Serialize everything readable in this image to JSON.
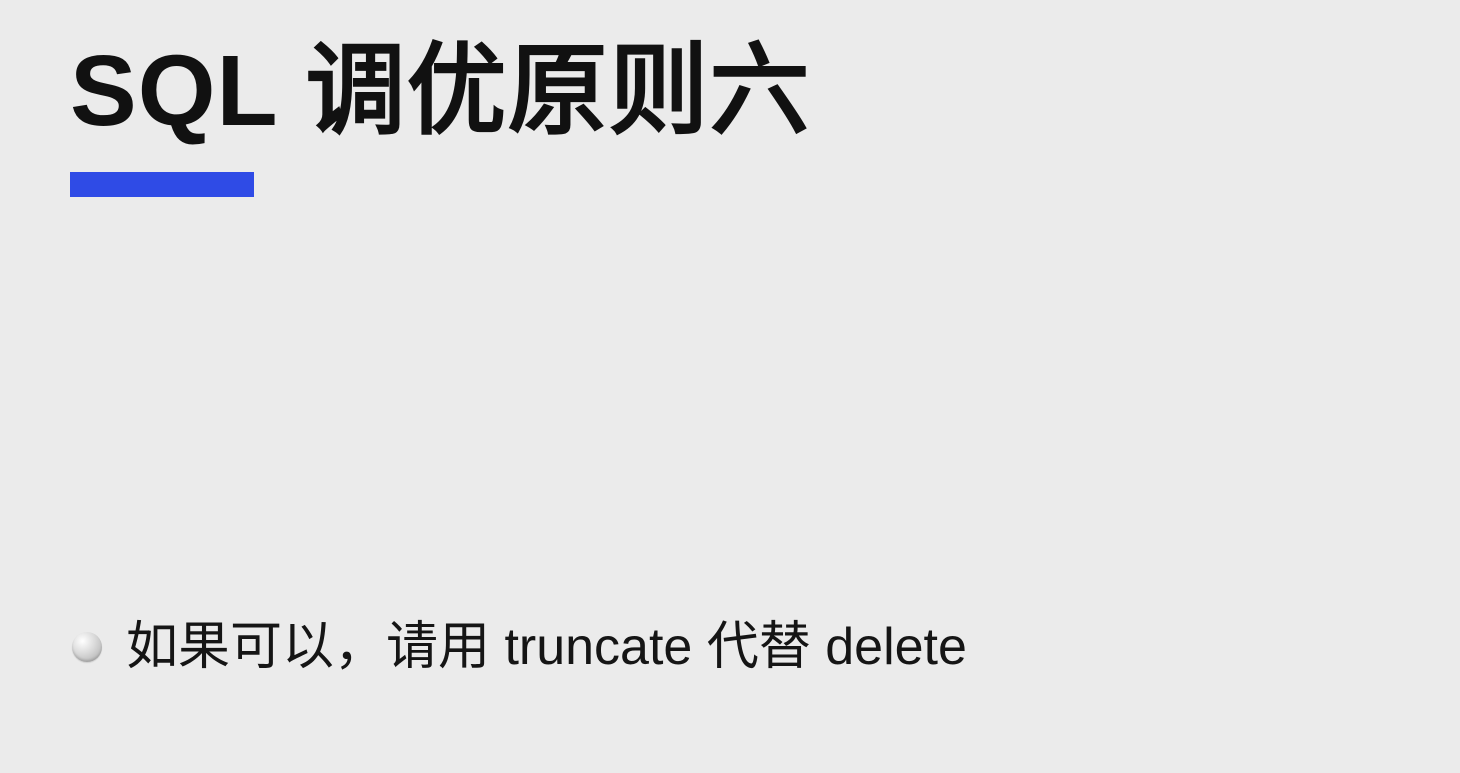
{
  "slide": {
    "title": "SQL 调优原则六",
    "accent_color": "#2f4be6",
    "bullets": [
      {
        "text": "如果可以，请用 truncate 代替 delete",
        "icon": "bullet-dot-icon"
      }
    ]
  }
}
